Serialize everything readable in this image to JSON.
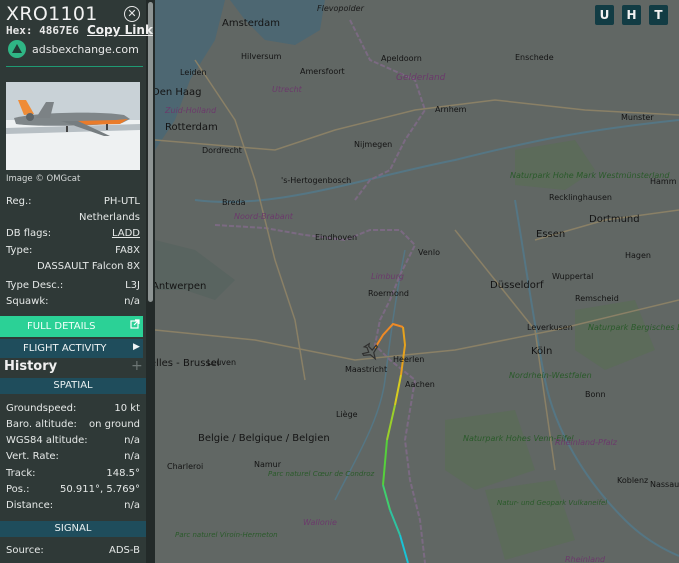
{
  "aircraft": {
    "callsign": "XRO1101",
    "hex_label": "Hex:",
    "hex": "4867E6",
    "copy_link": "Copy Link",
    "adsbx": "adsbexchange.com",
    "image_credit": "Image © OMGcat"
  },
  "details": [
    {
      "label": "Reg.:",
      "value": "PH-UTL"
    },
    {
      "label": "",
      "value": "Netherlands"
    },
    {
      "label": "DB flags:",
      "value": "LADD"
    },
    {
      "label": "Type:",
      "value": "FA8X"
    },
    {
      "label": "",
      "value": "DASSAULT Falcon 8X"
    },
    {
      "label": "Type Desc.:",
      "value": "L3J"
    },
    {
      "label": "Squawk:",
      "value": "n/a"
    }
  ],
  "buttons": {
    "full_details": "FULL DETAILS",
    "flight_activity": "FLIGHT ACTIVITY",
    "history": "History"
  },
  "spatial": {
    "title": "SPATIAL",
    "rows": [
      {
        "label": "Groundspeed:",
        "value": "10 kt"
      },
      {
        "label": "Baro. altitude:",
        "value": "on ground"
      },
      {
        "label": "WGS84 altitude:",
        "value": "n/a"
      },
      {
        "label": "Vert. Rate:",
        "value": "n/a"
      },
      {
        "label": "Track:",
        "value": "148.5°"
      },
      {
        "label": "Pos.:",
        "value": "50.911°, 5.769°"
      },
      {
        "label": "Distance:",
        "value": "n/a"
      }
    ]
  },
  "signal": {
    "title": "SIGNAL",
    "rows": [
      {
        "label": "Source:",
        "value": "ADS-B"
      }
    ]
  },
  "map": {
    "buttons": [
      "U",
      "H",
      "T"
    ],
    "places": [
      {
        "name": "Flevopolder",
        "style": "italic"
      },
      {
        "name": "Amsterdam",
        "style": "city"
      },
      {
        "name": "Hilversum",
        "style": "town"
      },
      {
        "name": "Amersfoort",
        "style": "town"
      },
      {
        "name": "Leiden",
        "style": "town"
      },
      {
        "name": "Den Haag",
        "style": "city"
      },
      {
        "name": "Zuid-Holland",
        "style": "region"
      },
      {
        "name": "Rotterdam",
        "style": "city"
      },
      {
        "name": "Dordrecht",
        "style": "town"
      },
      {
        "name": "Utrecht",
        "style": "region"
      },
      {
        "name": "Apeldoorn",
        "style": "town"
      },
      {
        "name": "Gelderland",
        "style": "region"
      },
      {
        "name": "Enschede",
        "style": "town"
      },
      {
        "name": "Nijmegen",
        "style": "town"
      },
      {
        "name": "Arnhem",
        "style": "town"
      },
      {
        "name": "Munster",
        "style": "town"
      },
      {
        "name": "Hamm",
        "style": "town"
      },
      {
        "name": "'s-Hertogenbosch",
        "style": "town"
      },
      {
        "name": "Breda",
        "style": "town"
      },
      {
        "name": "Noord-Brabant",
        "style": "region"
      },
      {
        "name": "Eindhoven",
        "style": "town"
      },
      {
        "name": "Naturpark Hohe Mark Westmünsterland",
        "style": "park"
      },
      {
        "name": "Recklinghausen",
        "style": "town"
      },
      {
        "name": "Dortmund",
        "style": "city"
      },
      {
        "name": "Essen",
        "style": "city"
      },
      {
        "name": "Hagen",
        "style": "town"
      },
      {
        "name": "Venlo",
        "style": "town"
      },
      {
        "name": "Antwerpen",
        "style": "city"
      },
      {
        "name": "Limburg",
        "style": "region"
      },
      {
        "name": "Roermond",
        "style": "town"
      },
      {
        "name": "Düsseldorf",
        "style": "city"
      },
      {
        "name": "Wuppertal",
        "style": "town"
      },
      {
        "name": "Remscheid",
        "style": "town"
      },
      {
        "name": "Leverkusen",
        "style": "town"
      },
      {
        "name": "Naturpark Bergisches Land",
        "style": "park"
      },
      {
        "name": "Köln",
        "style": "city"
      },
      {
        "name": "Bruxelles - Brussel",
        "style": "city"
      },
      {
        "name": "Leuven",
        "style": "town"
      },
      {
        "name": "Maastricht",
        "style": "town"
      },
      {
        "name": "Heerlen",
        "style": "town"
      },
      {
        "name": "Aachen",
        "style": "town"
      },
      {
        "name": "Bonn",
        "style": "town"
      },
      {
        "name": "Nordrhein-Westfalen",
        "style": "region"
      },
      {
        "name": "Liège",
        "style": "town"
      },
      {
        "name": "Belgie / Belgique / Belgien",
        "style": "country"
      },
      {
        "name": "Naturpark Hohes Venn-Eifel",
        "style": "park"
      },
      {
        "name": "Rheinland-Pfalz",
        "style": "region"
      },
      {
        "name": "Charleroi",
        "style": "town"
      },
      {
        "name": "Namur",
        "style": "town"
      },
      {
        "name": "Parc naturel Cœur de Condroz",
        "style": "park"
      },
      {
        "name": "Wallonie",
        "style": "region"
      },
      {
        "name": "Koblenz",
        "style": "town"
      },
      {
        "name": "Nassau",
        "style": "town"
      },
      {
        "name": "Natur- und Geopark Vulkaneifel",
        "style": "park"
      },
      {
        "name": "Parc naturel Viroin-Hermeton",
        "style": "park"
      },
      {
        "name": "Rheinland",
        "style": "region"
      }
    ]
  }
}
